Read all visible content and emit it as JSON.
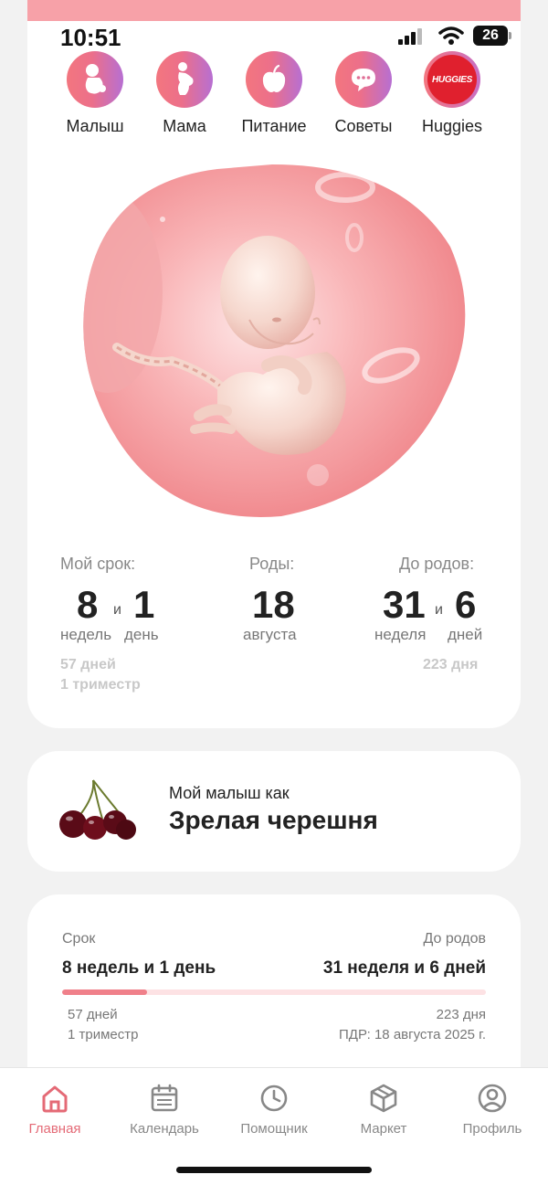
{
  "status_bar": {
    "time": "10:51",
    "battery": "26"
  },
  "categories": [
    {
      "label": "Малыш",
      "icon": "baby-icon"
    },
    {
      "label": "Мама",
      "icon": "mother-icon"
    },
    {
      "label": "Питание",
      "icon": "apple-icon"
    },
    {
      "label": "Советы",
      "icon": "chat-icon"
    },
    {
      "label": "Huggies",
      "icon": "huggies-logo",
      "logo_text": "HUGGIES"
    }
  ],
  "stats": {
    "term": {
      "label": "Мой срок:",
      "weeks": "8",
      "and": "и",
      "days": "1",
      "weeks_unit": "недель",
      "days_unit": "день",
      "total_days": "57 дней",
      "trimester": "1 триместр"
    },
    "birth": {
      "label": "Роды:",
      "day": "18",
      "month": "августа"
    },
    "until": {
      "label": "До родов:",
      "weeks": "31",
      "and": "и",
      "days": "6",
      "weeks_unit": "неделя",
      "days_unit": "дней",
      "total_days": "223 дня"
    }
  },
  "fruit_card": {
    "subtitle": "Мой малыш как",
    "title": "Зрелая черешня"
  },
  "progress_card": {
    "left_label": "Срок",
    "right_label": "До родов",
    "left_value": "8 недель и 1 день",
    "right_value": "31 неделя и 6 дней",
    "progress_fraction": 0.2,
    "left_days": "57 дней",
    "left_trimester": "1 триместр",
    "right_days": "223 дня",
    "due_date": "ПДР: 18 августа 2025 г."
  },
  "tabs": [
    {
      "label": "Главная",
      "icon": "home-icon",
      "active": true
    },
    {
      "label": "Календарь",
      "icon": "calendar-icon",
      "active": false
    },
    {
      "label": "Помощник",
      "icon": "clock-icon",
      "active": false
    },
    {
      "label": "Маркет",
      "icon": "box-icon",
      "active": false
    },
    {
      "label": "Профиль",
      "icon": "profile-icon",
      "active": false
    }
  ],
  "colors": {
    "accent": "#e46a76",
    "strip": "#f7a1a8",
    "gradient_start": "#f3767f",
    "gradient_end": "#b76fd2"
  }
}
